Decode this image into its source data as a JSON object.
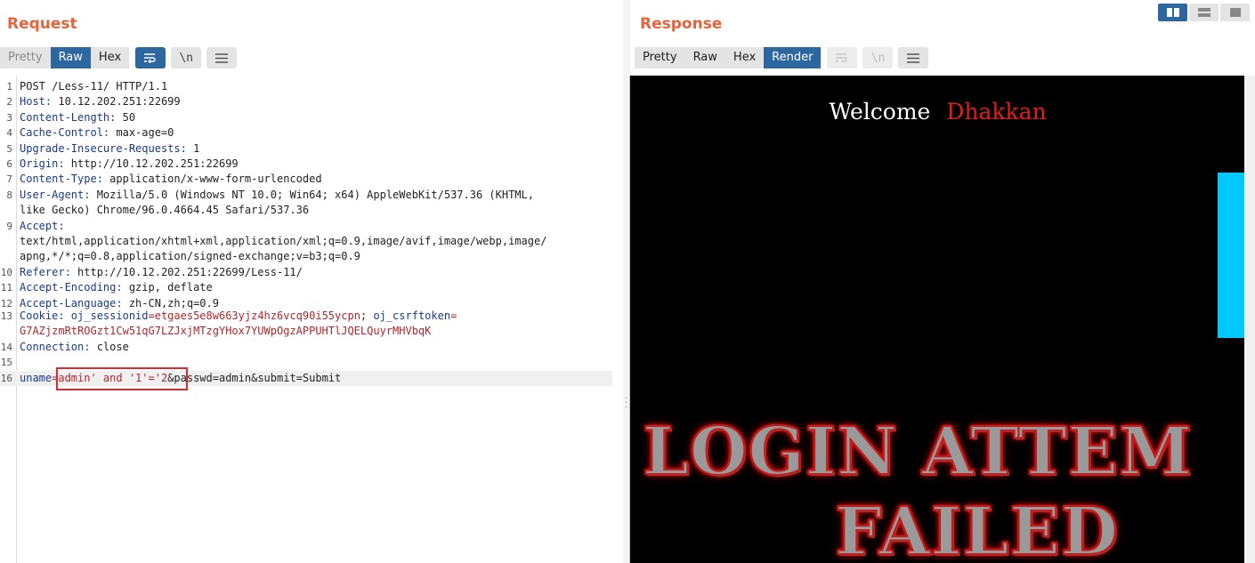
{
  "request": {
    "title": "Request",
    "tabs": [
      "Pretty",
      "Raw",
      "Hex"
    ],
    "active_tab": "Raw",
    "icons": [
      "wrap-icon",
      "newline-icon",
      "menu-icon"
    ],
    "lines": [
      {
        "n": "1",
        "key": "POST /Less-11/ HTTP/1.1",
        "val": ""
      },
      {
        "n": "2",
        "key": "Host:",
        "val": " 10.12.202.251:22699"
      },
      {
        "n": "3",
        "key": "Content-Length:",
        "val": " 50"
      },
      {
        "n": "4",
        "key": "Cache-Control:",
        "val": " max-age=0"
      },
      {
        "n": "5",
        "key": "Upgrade-Insecure-Requests:",
        "val": " 1"
      },
      {
        "n": "6",
        "key": "Origin:",
        "val": " http://10.12.202.251:22699"
      },
      {
        "n": "7",
        "key": "Content-Type:",
        "val": " application/x-www-form-urlencoded"
      },
      {
        "n": "8",
        "key": "User-Agent:",
        "val": " Mozilla/5.0 (Windows NT 10.0; Win64; x64) AppleWebKit/537.36 (KHTML,"
      },
      {
        "n": "",
        "key": "",
        "val": "like Gecko) Chrome/96.0.4664.45 Safari/537.36"
      },
      {
        "n": "9",
        "key": "Accept:",
        "val": ""
      },
      {
        "n": "",
        "key": "",
        "val": "text/html,application/xhtml+xml,application/xml;q=0.9,image/avif,image/webp,image/"
      },
      {
        "n": "",
        "key": "",
        "val": "apng,*/*;q=0.8,application/signed-exchange;v=b3;q=0.9"
      },
      {
        "n": "10",
        "key": "Referer:",
        "val": " http://10.12.202.251:22699/Less-11/"
      },
      {
        "n": "11",
        "key": "Accept-Encoding:",
        "val": " gzip, deflate"
      },
      {
        "n": "12",
        "key": "Accept-Language:",
        "val": " zh-CN,zh;q=0.9"
      }
    ],
    "cookie_line": {
      "n": "13",
      "key": "Cookie:",
      "c1k": " oj_sessionid",
      "c1v": "=etgaes5e8w663yjz4hz6vcq90i55ycpn",
      "sep": "; ",
      "c2k": "oj_csrftoken",
      "eq": "="
    },
    "cookie_cont": "G7AZjzmRtROGzt1Cw51qG7LZJxjMTzgYHox7YUWpOgzAPPUHTlJQELQuyrMHVbqK",
    "conn_line": {
      "n": "14",
      "key": "Connection:",
      "val": " close"
    },
    "blank_line": {
      "n": "15"
    },
    "body_line": {
      "n": "16",
      "k1": "uname",
      "v1": "=admin' and '1'='2",
      "rest": "&passwd=admin&submit=Submit"
    }
  },
  "response": {
    "title": "Response",
    "tabs": [
      "Pretty",
      "Raw",
      "Hex",
      "Render"
    ],
    "active_tab": "Render",
    "icons": [
      "wrap-icon",
      "newline-icon",
      "menu-icon"
    ],
    "welcome": "Welcome",
    "user": "Dhakkan",
    "failed_line1": "LOGIN ATTEM",
    "failed_line2": "FAILED"
  },
  "view_toggle": [
    "split-horizontal-icon",
    "split-vertical-icon",
    "single-pane-icon"
  ],
  "colors": {
    "accent": "#e8633a",
    "active_tab": "#2d67a0",
    "highlight_box": "#e0282e",
    "cyan": "#00c8ff"
  }
}
